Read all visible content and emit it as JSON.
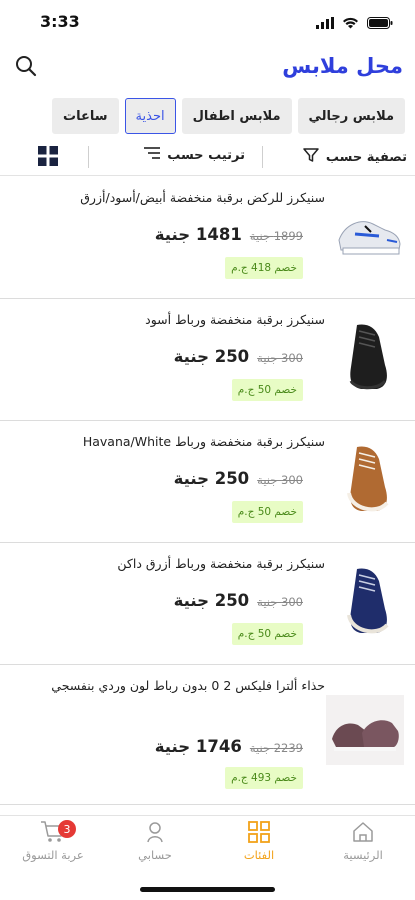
{
  "status_bar": {
    "time": "3:33"
  },
  "header": {
    "title": "محل ملابس"
  },
  "categories": [
    {
      "label": "ملابس رجالي",
      "active": false
    },
    {
      "label": "ملابس اطفال",
      "active": false
    },
    {
      "label": "احذية",
      "active": true
    },
    {
      "label": "ساعات",
      "active": false
    }
  ],
  "toolbar": {
    "filter_label": "تصفية حسب",
    "sort_label": "ترتيب حسب"
  },
  "products": [
    {
      "title": "سنيكرز للركض برقبة منخفضة أبيض/أسود/أزرق",
      "price": "1481 جنية",
      "old_price": "1899 جنية",
      "discount": "خصم 418 ج.م",
      "shoe_color": "#dfe3ea"
    },
    {
      "title": "سنيكرز برقبة منخفضة ورباط أسود",
      "price": "250 جنية",
      "old_price": "300 جنية",
      "discount": "خصم 50 ج.م",
      "shoe_color": "#1e1e1e"
    },
    {
      "title": "سنيكرز برقبة منخفضة ورباط Havana/White",
      "price": "250 جنية",
      "old_price": "300 جنية",
      "discount": "خصم 50 ج.م",
      "shoe_color": "#b06a32"
    },
    {
      "title": "سنيكرز برقبة منخفضة ورباط أزرق داكن",
      "price": "250 جنية",
      "old_price": "300 جنية",
      "discount": "خصم 50 ج.م",
      "shoe_color": "#1f2d6b"
    },
    {
      "title": "حذاء ألترا فليكس 2 0 بدون رباط لون وردي بنفسجي",
      "price": "1746 جنية",
      "old_price": "2239 جنية",
      "discount": "خصم 493 ج.م",
      "shoe_color": "#6b4a52"
    }
  ],
  "bottom_nav": {
    "home": "الرئيسية",
    "categories": "الفئات",
    "account": "حسابي",
    "cart": "عربة التسوق",
    "cart_count": "3"
  },
  "colors": {
    "accent": "#2f3fdc",
    "active_tab": "#f2a21a",
    "discount_bg": "#e8fcc5"
  }
}
